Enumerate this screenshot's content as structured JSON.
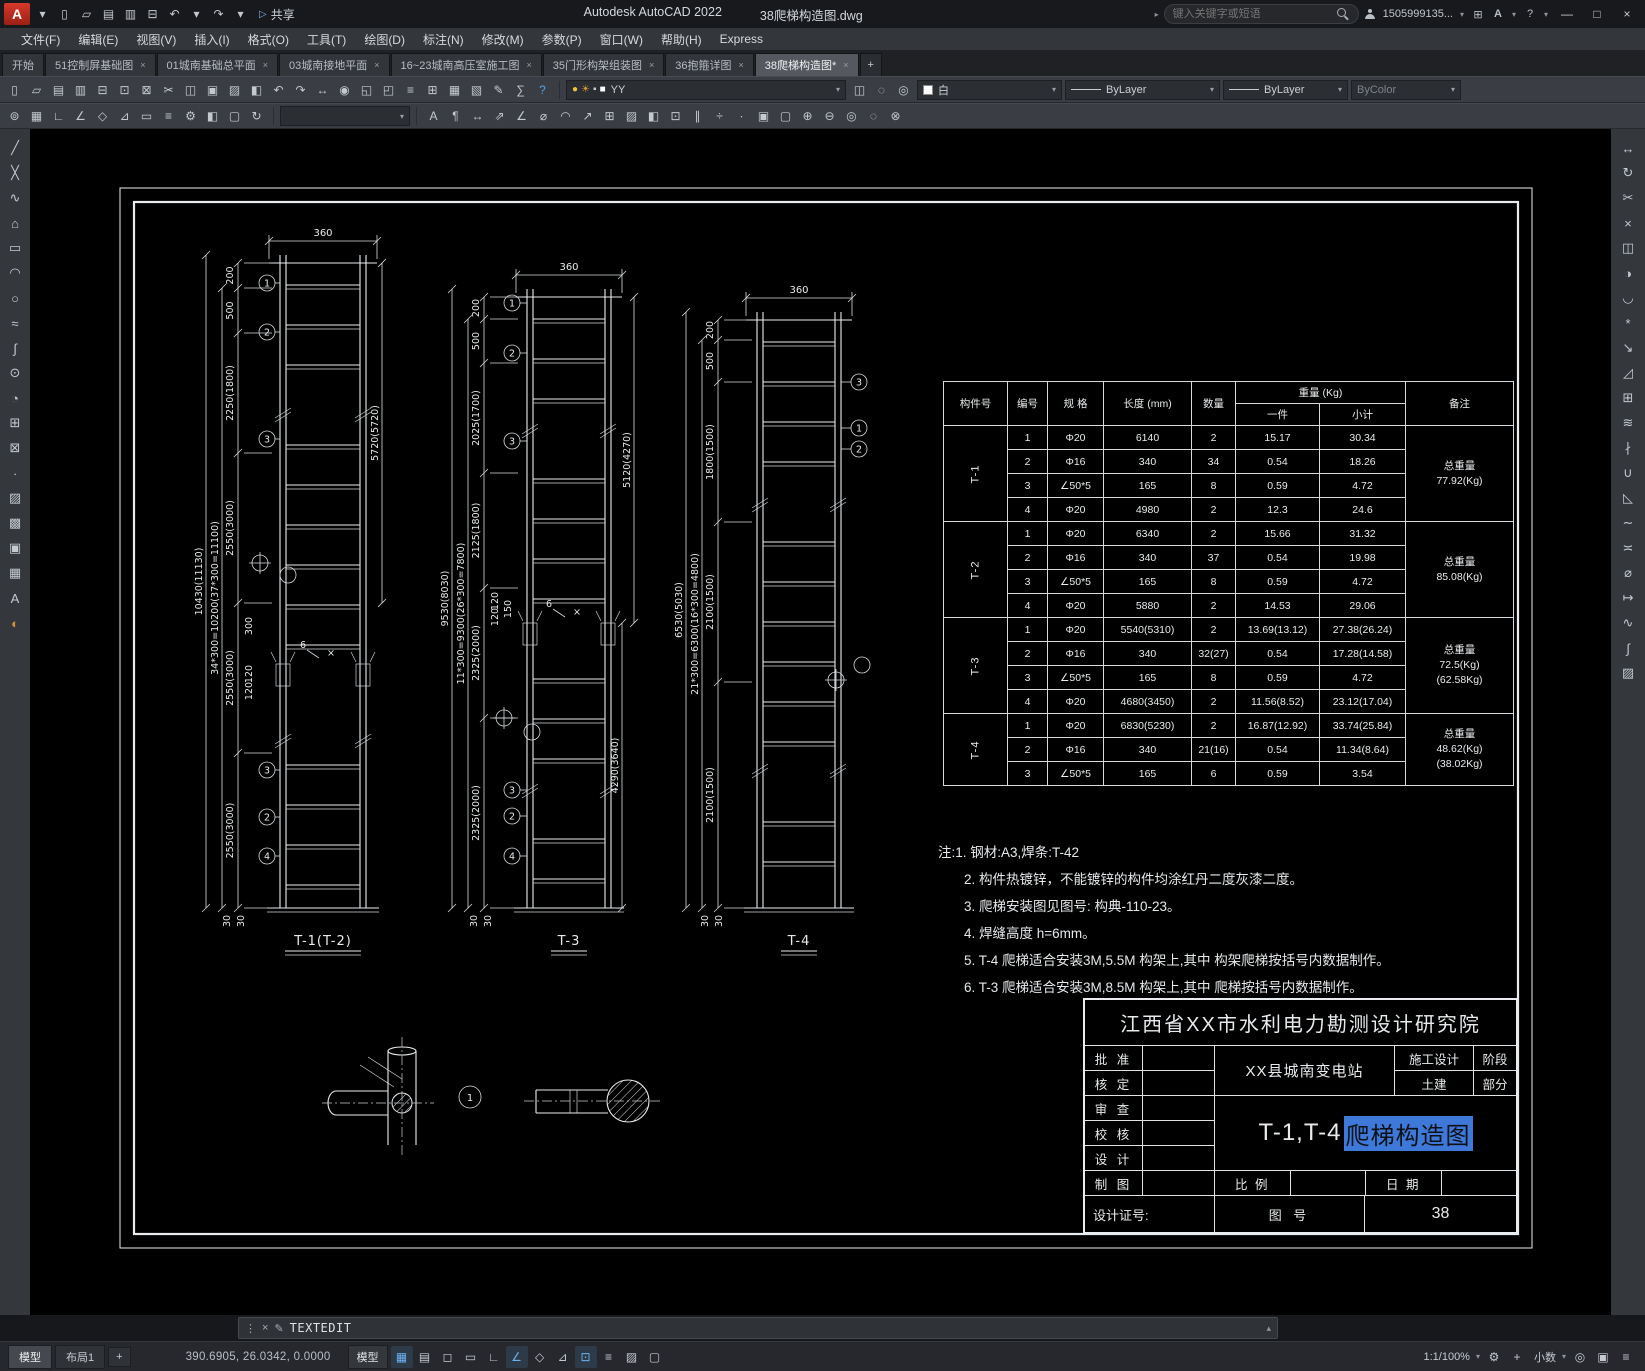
{
  "ui": {
    "caret": "▾",
    "cart": "⊞",
    "a_label": "A",
    "help": "?",
    "min": "—",
    "max": "□",
    "close": "×",
    "grip": "⋮",
    "pencil": "✎",
    "up": "▴",
    "share_glyph": "▷",
    "plus": "+"
  },
  "title_bar": {
    "app_title": "Autodesk AutoCAD 2022",
    "doc_title": "38爬梯构造图.dwg",
    "share_label": "共享",
    "search_placeholder": "键入关键字或短语",
    "user_id": "1505999135...",
    "icons": [
      {
        "n": "app-menu-caret",
        "g": "▾"
      },
      {
        "n": "qnew",
        "g": "▯"
      },
      {
        "n": "open",
        "g": "▱"
      },
      {
        "n": "qsave",
        "g": "▤"
      },
      {
        "n": "save-as",
        "g": "▥"
      },
      {
        "n": "plot",
        "g": "⊟"
      },
      {
        "n": "undo",
        "g": "↶"
      },
      {
        "n": "undo-caret",
        "g": "▾"
      },
      {
        "n": "redo",
        "g": "↷"
      },
      {
        "n": "redo-caret",
        "g": "▾"
      }
    ]
  },
  "menu_bar": {
    "items": [
      "文件(F)",
      "编辑(E)",
      "视图(V)",
      "插入(I)",
      "格式(O)",
      "工具(T)",
      "绘图(D)",
      "标注(N)",
      "修改(M)",
      "参数(P)",
      "窗口(W)",
      "帮助(H)",
      "Express"
    ]
  },
  "doc_tabs": {
    "tabs": [
      {
        "label": "开始",
        "closable": false,
        "active": false
      },
      {
        "label": "51控制屏基础图",
        "closable": true,
        "active": false
      },
      {
        "label": "01城南基础总平面",
        "closable": true,
        "active": false
      },
      {
        "label": "03城南接地平面",
        "closable": true,
        "active": false
      },
      {
        "label": "16~23城南高压室施工图",
        "closable": true,
        "active": false
      },
      {
        "label": "35门形构架组装图",
        "closable": true,
        "active": false
      },
      {
        "label": "36抱箍详图",
        "closable": true,
        "active": false
      },
      {
        "label": "38爬梯构造图*",
        "closable": true,
        "active": true
      }
    ],
    "new_tab": "+"
  },
  "toolbar1": {
    "icons": [
      {
        "n": "qnew",
        "g": "▯"
      },
      {
        "n": "open",
        "g": "▱"
      },
      {
        "n": "qsave",
        "g": "▤"
      },
      {
        "n": "save-all",
        "g": "▥"
      },
      {
        "n": "plot",
        "g": "⊟"
      },
      {
        "n": "plot-preview",
        "g": "⊡"
      },
      {
        "n": "publish",
        "g": "⊠"
      },
      {
        "n": "cut",
        "g": "✂"
      },
      {
        "n": "copy-clip",
        "g": "◫"
      },
      {
        "n": "paste",
        "g": "▣"
      },
      {
        "n": "match-properties",
        "g": "▨"
      },
      {
        "n": "block-editor",
        "g": "◧"
      },
      {
        "n": "undo",
        "g": "↶"
      },
      {
        "n": "redo",
        "g": "↷"
      },
      {
        "n": "pan-realtime",
        "g": "↔"
      },
      {
        "n": "zoom-realtime",
        "g": "◉"
      },
      {
        "n": "zoom-window",
        "g": "◱"
      },
      {
        "n": "zoom-previous",
        "g": "◰"
      },
      {
        "n": "properties-palette",
        "g": "≡"
      },
      {
        "n": "design-center",
        "g": "⊞"
      },
      {
        "n": "tool-palettes",
        "g": "▦"
      },
      {
        "n": "sheet-set-manager",
        "g": "▧"
      },
      {
        "n": "markup-set",
        "g": "✎"
      },
      {
        "n": "quick-calc",
        "g": "∑"
      },
      {
        "n": "help",
        "g": "?",
        "c": "#4ea3e8"
      }
    ],
    "layer_icons": [
      {
        "n": "layer-on",
        "g": "●",
        "c": "#f0c040"
      },
      {
        "n": "layer-sun",
        "g": "☀",
        "c": "#e0983a"
      },
      {
        "n": "layer-lock",
        "g": "▪",
        "c": "#c8cdd2"
      },
      {
        "n": "layer-color-chip",
        "g": "■",
        "c": "#ffffff"
      }
    ],
    "layer_value": "YY",
    "icons2": [
      {
        "n": "layer-states",
        "g": "◫"
      },
      {
        "n": "layer-off",
        "g": "◌"
      },
      {
        "n": "layer-isolate",
        "g": "◎"
      }
    ],
    "color_value": "白",
    "linetype": "ByLayer",
    "lineweight": "ByLayer",
    "plotstyle": "ByColor"
  },
  "toolbar2": {
    "icons_a": [
      {
        "n": "snap-settings",
        "g": "⊚"
      },
      {
        "n": "grid-settings",
        "g": "▦"
      },
      {
        "n": "ortho",
        "g": "∟"
      },
      {
        "n": "polar",
        "g": "∠"
      },
      {
        "n": "osnap",
        "g": "◇"
      },
      {
        "n": "otrack",
        "g": "⊿"
      },
      {
        "n": "dyn-input",
        "g": "▭"
      },
      {
        "n": "lwt-display",
        "g": "≡"
      },
      {
        "n": "workspace",
        "g": "⚙"
      },
      {
        "n": "view-cube",
        "g": "◧"
      },
      {
        "n": "named-views",
        "g": "▢"
      },
      {
        "n": "regen",
        "g": "↻"
      }
    ],
    "combo_value": "",
    "icons_b": [
      {
        "n": "text",
        "g": "A"
      },
      {
        "n": "mtext",
        "g": "¶"
      },
      {
        "n": "dim-linear",
        "g": "↔"
      },
      {
        "n": "dim-aligned",
        "g": "⇗"
      },
      {
        "n": "dim-angular",
        "g": "∠"
      },
      {
        "n": "dim-radius",
        "g": "⌀"
      },
      {
        "n": "dim-arc",
        "g": "◠"
      },
      {
        "n": "leader",
        "g": "↗"
      },
      {
        "n": "table",
        "g": "⊞"
      },
      {
        "n": "hatch",
        "g": "▨"
      },
      {
        "n": "block",
        "g": "◧"
      },
      {
        "n": "insert",
        "g": "⊡"
      },
      {
        "n": "measure",
        "g": "∥"
      },
      {
        "n": "divide",
        "g": "÷"
      },
      {
        "n": "point-style",
        "g": "∙"
      },
      {
        "n": "region",
        "g": "▣"
      },
      {
        "n": "boundary",
        "g": "▢"
      },
      {
        "n": "group",
        "g": "⊕"
      },
      {
        "n": "ungroup",
        "g": "⊖"
      },
      {
        "n": "isolate-objects",
        "g": "◎"
      },
      {
        "n": "hide-objects",
        "g": "◌"
      },
      {
        "n": "overkill",
        "g": "⊗"
      }
    ]
  },
  "left_toolbar": {
    "icons": [
      {
        "n": "line",
        "g": "╱"
      },
      {
        "n": "construction-line",
        "g": "╳"
      },
      {
        "n": "polyline",
        "g": "∿"
      },
      {
        "n": "polygon",
        "g": "⌂"
      },
      {
        "n": "rectangle",
        "g": "▭"
      },
      {
        "n": "arc",
        "g": "◠"
      },
      {
        "n": "circle",
        "g": "○"
      },
      {
        "n": "revision-cloud",
        "g": "≈"
      },
      {
        "n": "spline",
        "g": "∫"
      },
      {
        "n": "ellipse",
        "g": "⊙"
      },
      {
        "n": "ellipse-arc",
        "g": "◔"
      },
      {
        "n": "insert-block",
        "g": "⊞"
      },
      {
        "n": "make-block",
        "g": "⊠"
      },
      {
        "n": "point",
        "g": "∙"
      },
      {
        "n": "hatch",
        "g": "▨"
      },
      {
        "n": "gradient",
        "g": "▩"
      },
      {
        "n": "region",
        "g": "▣"
      },
      {
        "n": "table",
        "g": "▦"
      },
      {
        "n": "multiline-text",
        "g": "A"
      },
      {
        "n": "palette",
        "g": "◐",
        "c": "#d98f3e"
      }
    ]
  },
  "right_toolbar": {
    "icons": [
      {
        "n": "move",
        "g": "↔"
      },
      {
        "n": "rotate",
        "g": "↻"
      },
      {
        "n": "trim",
        "g": "✂"
      },
      {
        "n": "erase",
        "g": "×"
      },
      {
        "n": "copy",
        "g": "◫"
      },
      {
        "n": "mirror",
        "g": "◑"
      },
      {
        "n": "fillet",
        "g": "◡"
      },
      {
        "n": "explode",
        "g": "*"
      },
      {
        "n": "stretch",
        "g": "↘"
      },
      {
        "n": "scale",
        "g": "◿"
      },
      {
        "n": "array",
        "g": "⊞"
      },
      {
        "n": "offset",
        "g": "≋"
      },
      {
        "n": "break",
        "g": "∤"
      },
      {
        "n": "join",
        "g": "∪"
      },
      {
        "n": "chamfer",
        "g": "◺"
      },
      {
        "n": "blend",
        "g": "∼"
      },
      {
        "n": "align",
        "g": "≍"
      },
      {
        "n": "measure-geom",
        "g": "⌀"
      },
      {
        "n": "lengthen",
        "g": "↦"
      },
      {
        "n": "edit-polyline",
        "g": "∿"
      },
      {
        "n": "edit-spline",
        "g": "∫"
      },
      {
        "n": "edit-hatch",
        "g": "▨"
      }
    ]
  },
  "command_line": {
    "text": "TEXTEDIT"
  },
  "status_bar": {
    "model_tab": "模型",
    "layout_tab": "布局1",
    "new_layout": "+",
    "coords": "390.6905, 26.0342, 0.0000",
    "model_toggle": "模型",
    "icons": [
      {
        "n": "grid",
        "g": "▦",
        "on": true
      },
      {
        "n": "snap-mode",
        "g": "▤"
      },
      {
        "n": "infer-constraints",
        "g": "◻"
      },
      {
        "n": "dynamic-input",
        "g": "▭"
      },
      {
        "n": "ortho-mode",
        "g": "∟"
      },
      {
        "n": "polar-tracking",
        "g": "∠",
        "on": true
      },
      {
        "n": "isometric-drafting",
        "g": "◇"
      },
      {
        "n": "object-snap-tracking",
        "g": "⊿"
      },
      {
        "n": "object-snap",
        "g": "⊡",
        "on": true
      },
      {
        "n": "lineweight-toggle",
        "g": "≡"
      },
      {
        "n": "transparency",
        "g": "▨"
      },
      {
        "n": "selection-cycling",
        "g": "▢"
      }
    ],
    "scale": "1:1/100%",
    "right_icons1": [
      {
        "n": "workspace-gear",
        "g": "⚙"
      },
      {
        "n": "annotation-plus",
        "g": "+"
      }
    ],
    "decimal": "小数",
    "right_icons2": [
      {
        "n": "object-isolate",
        "g": "◎"
      },
      {
        "n": "graphics-performance",
        "g": "▣"
      },
      {
        "n": "customization",
        "g": "≡"
      }
    ]
  },
  "drawing": {
    "ladders": [
      {
        "label": "T-1(T-2)",
        "top_dim": "360",
        "seg_dims": [
          "200",
          "500",
          "2250(1800)",
          "2550(3000)",
          "2550(3000)",
          "2550(3000)"
        ],
        "pitch_dim": "34*300=10200(37*300=11100)",
        "total_dim": "10430(11130)",
        "side_dims": [
          "5720(5720)"
        ],
        "sub_dims": [
          "300",
          "120",
          "120",
          "30",
          "30"
        ],
        "weld_label": "6",
        "balloons": [
          "1",
          "2",
          "3",
          "3",
          "2",
          "4"
        ]
      },
      {
        "label": "T-3",
        "top_dim": "360",
        "seg_dims": [
          "200",
          "500",
          "2025(1700)",
          "2125(1800)",
          "2325(2000)",
          "2325(2000)"
        ],
        "pitch_dim": "11*300=9300(26*300=7800)",
        "total_dim": "9530(8030)",
        "side_dims": [
          "5120(4270)",
          "4290(3640)"
        ],
        "sub_dims": [
          "120",
          "120",
          "150",
          "30",
          "30"
        ],
        "weld_label": "6",
        "balloons": [
          "1",
          "2",
          "3",
          "3",
          "2",
          "4"
        ]
      },
      {
        "label": "T-4",
        "top_dim": "360",
        "seg_dims": [
          "200",
          "500",
          "1800(1500)",
          "2100(1500)",
          "2100(1500)"
        ],
        "pitch_dim": "21*300=6300(16*300=4800)",
        "total_dim": "6530(5030)",
        "side_dims": [],
        "sub_dims": [
          "30",
          "30"
        ],
        "weld_label": "",
        "balloons": [
          "3",
          "1",
          "2"
        ]
      }
    ],
    "table": {
      "col_headers": {
        "part": "构件号",
        "no": "编号",
        "spec": "规 格",
        "length": "长度 (mm)",
        "qty": "数量",
        "weight": "重量 (Kg)",
        "one": "一件",
        "subtotal": "小计",
        "remark": "备注"
      },
      "groups": [
        {
          "part": "T-1",
          "remark_lines": [
            "总重量",
            "77.92(Kg)"
          ],
          "rows": [
            [
              "1",
              "Φ20",
              "6140",
              "2",
              "15.17",
              "30.34"
            ],
            [
              "2",
              "Φ16",
              "340",
              "34",
              "0.54",
              "18.26"
            ],
            [
              "3",
              "∠50*5",
              "165",
              "8",
              "0.59",
              "4.72"
            ],
            [
              "4",
              "Φ20",
              "4980",
              "2",
              "12.3",
              "24.6"
            ]
          ]
        },
        {
          "part": "T-2",
          "remark_lines": [
            "总重量",
            "85.08(Kg)"
          ],
          "rows": [
            [
              "1",
              "Φ20",
              "6340",
              "2",
              "15.66",
              "31.32"
            ],
            [
              "2",
              "Φ16",
              "340",
              "37",
              "0.54",
              "19.98"
            ],
            [
              "3",
              "∠50*5",
              "165",
              "8",
              "0.59",
              "4.72"
            ],
            [
              "4",
              "Φ20",
              "5880",
              "2",
              "14.53",
              "29.06"
            ]
          ]
        },
        {
          "part": "T-3",
          "remark_lines": [
            "总重量",
            "72.5(Kg)",
            "(62.58Kg)"
          ],
          "rows": [
            [
              "1",
              "Φ20",
              "5540(5310)",
              "2",
              "13.69(13.12)",
              "27.38(26.24)"
            ],
            [
              "2",
              "Φ16",
              "340",
              "32(27)",
              "0.54",
              "17.28(14.58)"
            ],
            [
              "3",
              "∠50*5",
              "165",
              "8",
              "0.59",
              "4.72"
            ],
            [
              "4",
              "Φ20",
              "4680(3450)",
              "2",
              "11.56(8.52)",
              "23.12(17.04)"
            ]
          ]
        },
        {
          "part": "T-4",
          "remark_lines": [
            "总重量",
            "48.62(Kg)",
            "(38.02Kg)"
          ],
          "rows": [
            [
              "1",
              "Φ20",
              "6830(5230)",
              "2",
              "16.87(12.92)",
              "33.74(25.84)"
            ],
            [
              "2",
              "Φ16",
              "340",
              "21(16)",
              "0.54",
              "11.34(8.64)"
            ],
            [
              "3",
              "∠50*5",
              "165",
              "6",
              "0.59",
              "3.54"
            ]
          ]
        }
      ]
    },
    "notes": {
      "prefix": "注:",
      "items": [
        "1. 钢材:A3,焊条:T-42",
        "2. 构件热镀锌，不能镀锌的构件均涂红丹二度灰漆二度。",
        "3. 爬梯安装图见图号: 构典-110-23。",
        "4. 焊缝高度 h=6mm。",
        "5. T-4 爬梯适合安装3M,5.5M 构架上,其中 构架爬梯按括号内数据制作。",
        "6. T-3 爬梯适合安装3M,8.5M 构架上,其中 爬梯按括号内数据制作。"
      ]
    },
    "title_block": {
      "org": "江西省XX市水利电力勘测设计研究院",
      "rows": [
        "批 准",
        "核 定",
        "审 查",
        "校 核",
        "设 计",
        "制 图"
      ],
      "project": "XX县城南变电站",
      "stage_label": "施工设计",
      "stage_suffix": "阶段",
      "part_label": "土建",
      "part_suffix": "部分",
      "drawing_title_prefix": "T-1,T-4",
      "drawing_title_selected": "爬梯构造图",
      "scale_label": "比 例",
      "date_label": "日 期",
      "cert_label": "设计证号:",
      "figno_label": "图 号",
      "figno_value": "38"
    },
    "details": {
      "balloon": "1"
    }
  }
}
